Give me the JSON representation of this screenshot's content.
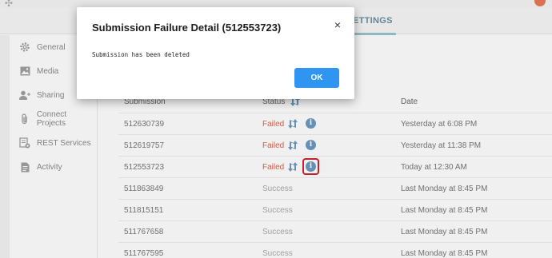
{
  "header": {
    "tabs": [
      {
        "label": "ETTINGS",
        "active": true
      }
    ]
  },
  "sidebar": {
    "items": [
      {
        "label": "General",
        "icon": "gear-icon"
      },
      {
        "label": "Media",
        "icon": "image-icon"
      },
      {
        "label": "Sharing",
        "icon": "user-plus-icon"
      },
      {
        "label": "Connect Projects",
        "icon": "paperclip-icon"
      },
      {
        "label": "REST Services",
        "icon": "rest-icon"
      },
      {
        "label": "Activity",
        "icon": "document-icon"
      }
    ]
  },
  "table": {
    "columns": {
      "submission": "Submission",
      "status": "Status",
      "date": "Date"
    },
    "rows": [
      {
        "submission": "512630739",
        "status": "Failed",
        "date": "Yesterday at 6:08 PM"
      },
      {
        "submission": "512619757",
        "status": "Failed",
        "date": "Yesterday at 11:38 PM"
      },
      {
        "submission": "512553723",
        "status": "Failed",
        "date": "Today at 12:30 AM",
        "highlighted": true
      },
      {
        "submission": "511863849",
        "status": "Success",
        "date": "Last Monday at 8:45 PM"
      },
      {
        "submission": "511815151",
        "status": "Success",
        "date": "Last Monday at 8:45 PM"
      },
      {
        "submission": "511767658",
        "status": "Success",
        "date": "Last Monday at 8:45 PM"
      },
      {
        "submission": "511767595",
        "status": "Success",
        "date": "Last Monday at 8:45 PM"
      }
    ]
  },
  "modal": {
    "title": "Submission Failure Detail (512553723)",
    "close_symbol": "×",
    "message": "Submission has been deleted",
    "ok_label": "OK"
  },
  "colors": {
    "failed": "#d9634e",
    "success": "#aaaaaa",
    "info": "#6d9bc3",
    "ok_button": "#2f95f0",
    "highlight": "#d4222b"
  }
}
